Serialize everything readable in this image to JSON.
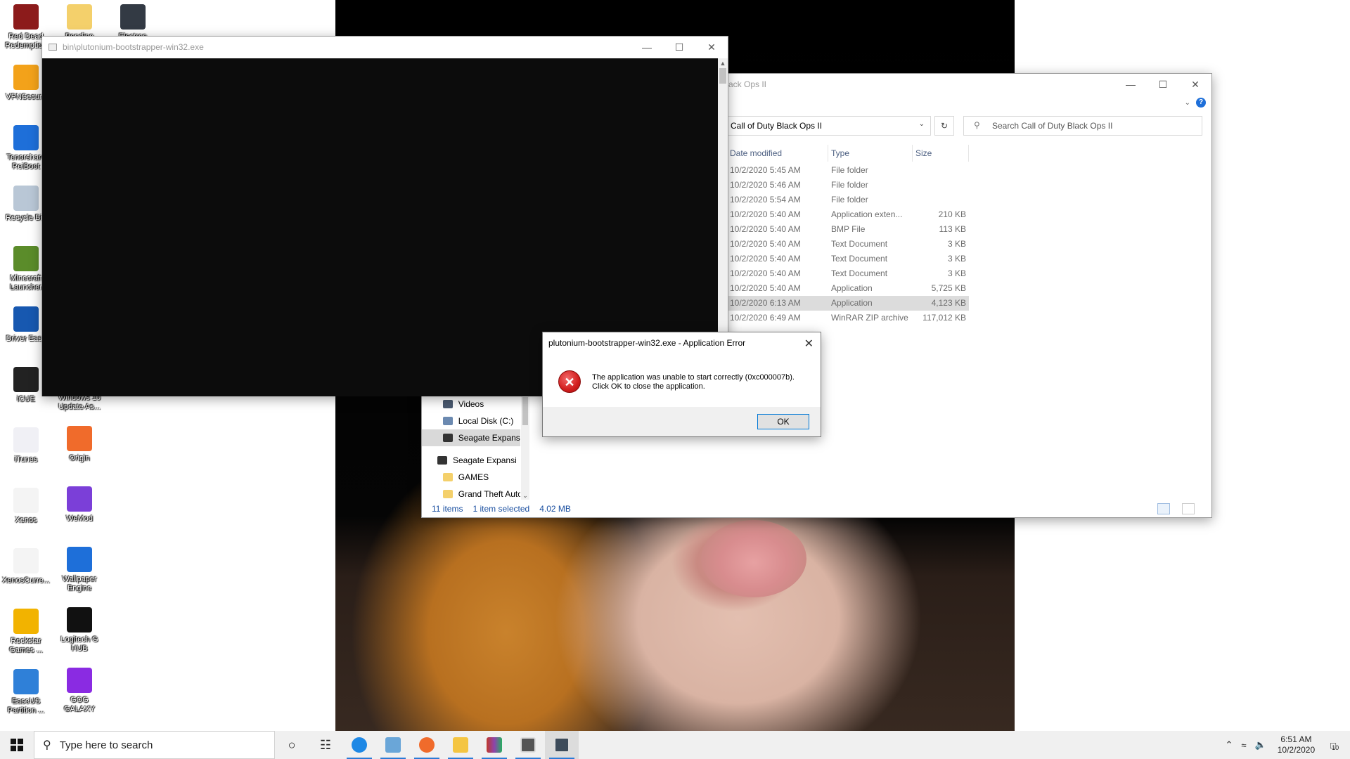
{
  "desktop": {
    "icons_col1": [
      {
        "label": "Red Dead Redemption",
        "color": "#8c1b1b"
      },
      {
        "label": "VPNSecure",
        "color": "#f3a21a"
      },
      {
        "label": "Tenorshare ReiBoot",
        "color": "#1e6fd9"
      },
      {
        "label": "Recycle Bin",
        "color": "#b9c7d6"
      },
      {
        "label": "Minecraft Launcher",
        "color": "#5b8c2a"
      },
      {
        "label": "Driver Easy",
        "color": "#1758b0"
      },
      {
        "label": "iCUE",
        "color": "#222222"
      },
      {
        "label": "iTunes",
        "color": "#f0f0f5"
      },
      {
        "label": "Xenos",
        "color": "#f4f4f4"
      },
      {
        "label": "XenosCurre...",
        "color": "#f4f4f4"
      },
      {
        "label": "Rockstar Games ...",
        "color": "#f2b300"
      },
      {
        "label": "EaseUS Partition ...",
        "color": "#2f80d8"
      }
    ],
    "icons_col2": [
      {
        "label": "Pending",
        "color": "#f4d06b"
      },
      {
        "label": "Windows 10 Update As...",
        "color": "#3a7bd5"
      },
      {
        "label": "Origin",
        "color": "#f06b2b"
      },
      {
        "label": "WeMod",
        "color": "#7b3fd8"
      },
      {
        "label": "Wallpaper Engine",
        "color": "#1e6fd9"
      },
      {
        "label": "Logitech G HUB",
        "color": "#111111"
      },
      {
        "label": "GOG GALAXY",
        "color": "#8a2be2"
      }
    ],
    "icons_col3": [
      {
        "label": "Electron",
        "color": "#333a44"
      }
    ]
  },
  "console": {
    "title": "bin\\plutonium-bootstrapper-win32.exe"
  },
  "explorer": {
    "title_partial": "ack Ops II",
    "address": "Call of Duty Black Ops II",
    "search_placeholder": "Search Call of Duty Black Ops II",
    "columns": [
      "Date modified",
      "Type",
      "Size"
    ],
    "rows": [
      {
        "date": "10/2/2020 5:45 AM",
        "type": "File folder",
        "size": ""
      },
      {
        "date": "10/2/2020 5:46 AM",
        "type": "File folder",
        "size": ""
      },
      {
        "date": "10/2/2020 5:54 AM",
        "type": "File folder",
        "size": ""
      },
      {
        "date": "10/2/2020 5:40 AM",
        "type": "Application exten...",
        "size": "210 KB"
      },
      {
        "date": "10/2/2020 5:40 AM",
        "type": "BMP File",
        "size": "113 KB"
      },
      {
        "date": "10/2/2020 5:40 AM",
        "type": "Text Document",
        "size": "3 KB"
      },
      {
        "date": "10/2/2020 5:40 AM",
        "type": "Text Document",
        "size": "3 KB"
      },
      {
        "date": "10/2/2020 5:40 AM",
        "type": "Text Document",
        "size": "3 KB"
      },
      {
        "date": "10/2/2020 5:40 AM",
        "type": "Application",
        "size": "5,725 KB"
      },
      {
        "date": "10/2/2020 6:13 AM",
        "type": "Application",
        "size": "4,123 KB",
        "selected": true
      },
      {
        "date": "10/2/2020 6:49 AM",
        "type": "WinRAR ZIP archive",
        "size": "117,012 KB"
      }
    ],
    "nav": [
      {
        "label": "Videos",
        "color": "#4a5a70"
      },
      {
        "label": "Local Disk (C:)",
        "color": "#6b89b0"
      },
      {
        "label": "Seagate Expansio",
        "color": "#333333",
        "selected": true
      },
      {
        "label": "Seagate Expansion",
        "color": "#333333"
      },
      {
        "label": "GAMES",
        "color": "#f4d06b"
      },
      {
        "label": "Grand Theft Auto",
        "color": "#f4d06b"
      }
    ],
    "status": {
      "items": "11 items",
      "selected": "1 item selected",
      "size": "4.02 MB"
    }
  },
  "dialog": {
    "title": "plutonium-bootstrapper-win32.exe - Application Error",
    "message_line1": "The application was unable to start correctly (0xc000007b).",
    "message_line2": "Click OK to close the application.",
    "ok_label": "OK"
  },
  "taskbar": {
    "search_placeholder": "Type here to search",
    "time": "6:51 AM",
    "date": "10/2/2020",
    "notification_count": "10"
  }
}
